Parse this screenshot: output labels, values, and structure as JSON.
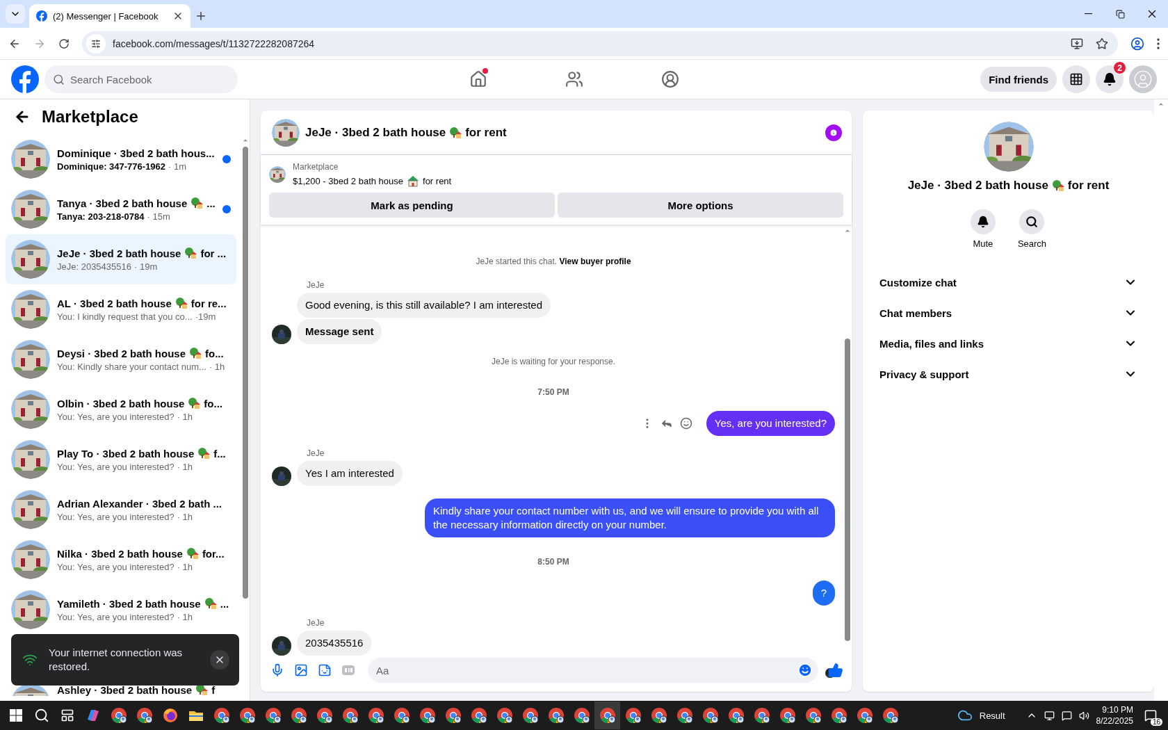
{
  "browser": {
    "tab": {
      "title": "(2) Messenger | Facebook",
      "selected": true
    },
    "url": "facebook.com/messages/t/1132722282087264"
  },
  "header": {
    "search": {
      "placeholder": "Search Facebook"
    },
    "nav": [
      {
        "kind": "home",
        "selected": false,
        "dot": true
      },
      {
        "kind": "friends",
        "selected": false,
        "dot": false
      },
      {
        "kind": "groups",
        "selected": false,
        "dot": false
      }
    ],
    "find_friends": "Find friends",
    "notifications_badge": "2"
  },
  "sidebar": {
    "title": "Marketplace",
    "conversations": [
      {
        "title": {
          "text": "Dominique · 3bed 2 bath hous...",
          "kind": "plain"
        },
        "preview": "Dominique: 347-776-1962",
        "time": "· 1m",
        "unread": true,
        "selected": false
      },
      {
        "title": {
          "text": "Tanya · 3bed 2 bath house",
          "kind": "house_tree",
          "after": "..."
        },
        "preview": "Tanya: 203-218-0784",
        "time": "· 15m",
        "unread": true,
        "selected": false
      },
      {
        "title": {
          "text": "JeJe · 3bed 2 bath house",
          "kind": "house_tree",
          "after": "for ..."
        },
        "preview": "JeJe: 2035435516",
        "time": "· 19m",
        "unread": false,
        "selected": true
      },
      {
        "title": {
          "text": "AL · 3bed 2 bath house",
          "kind": "house_tree",
          "after": "for re..."
        },
        "preview": "You: I kindly request that you co...",
        "time": "·19m",
        "unread": false,
        "selected": false
      },
      {
        "title": {
          "text": "Deysi · 3bed 2 bath house",
          "kind": "house_tree",
          "after": "fo..."
        },
        "preview": "You: Kindly share your contact num...",
        "time": "· 1h",
        "unread": false,
        "selected": false
      },
      {
        "title": {
          "text": "Olbin · 3bed 2 bath house",
          "kind": "house_tree",
          "after": "fo..."
        },
        "preview": "You: Yes, are you interested?",
        "time": "· 1h",
        "unread": false,
        "selected": false
      },
      {
        "title": {
          "text": "Play To · 3bed 2 bath house",
          "kind": "house_tree",
          "after": "f..."
        },
        "preview": "You: Yes, are you interested?",
        "time": "· 1h",
        "unread": false,
        "selected": false
      },
      {
        "title": {
          "text": "Adrian Alexander · 3bed 2 bath ...",
          "kind": "plain"
        },
        "preview": "You: Yes, are you interested?",
        "time": "· 1h",
        "unread": false,
        "selected": false
      },
      {
        "title": {
          "text": "Nilka · 3bed 2 bath house",
          "kind": "house_tree",
          "after": "for..."
        },
        "preview": "You: Yes, are you interested?",
        "time": "· 1h",
        "unread": false,
        "selected": false
      },
      {
        "title": {
          "text": "Yamileth · 3bed 2 bath house",
          "kind": "house_tree",
          "after": "..."
        },
        "preview": "You: Yes, are you interested?",
        "time": "· 1h",
        "unread": false,
        "selected": false
      },
      {
        "title": {
          "text": "Ashley · 3bed 2 bath house",
          "kind": "house_tree",
          "after": "f"
        },
        "selected": false
      }
    ],
    "toast": "Your internet connection was restored."
  },
  "chat": {
    "title": {
      "text": "JeJe · 3bed 2 bath house",
      "kind": "house_tree",
      "after": "for rent"
    },
    "listing": {
      "label": "Marketplace",
      "title": {
        "text": "$1,200 - 3bed 2 bath house",
        "kind": "house",
        "after": "for rent"
      },
      "buttons": [
        "Mark as pending",
        "More options"
      ]
    },
    "messages": [
      {
        "kind": "system",
        "text": "JeJe started this chat.",
        "link": "View buyer profile"
      },
      {
        "kind": "incoming",
        "sender": "JeJe",
        "bubbles": [
          {
            "text": "Good evening, is this still available? I am interested",
            "bold": false
          },
          {
            "text": "Message sent",
            "bold": true
          }
        ]
      },
      {
        "kind": "system",
        "text": "JeJe is waiting for your response."
      },
      {
        "kind": "time",
        "text": "7:50 PM"
      },
      {
        "kind": "outgoing",
        "text": "Yes, are you interested?",
        "color": "#6530f6",
        "actions": true
      },
      {
        "kind": "incoming",
        "sender": "JeJe",
        "bubbles": [
          {
            "text": "Yes I am interested",
            "bold": false
          }
        ]
      },
      {
        "kind": "outgoing",
        "text": "Kindly share your contact number with us, and we will ensure to provide you with all the necessary information directly on your number.",
        "color": "#3a4ff5"
      },
      {
        "kind": "time",
        "text": "8:50 PM"
      },
      {
        "kind": "outgoing",
        "text": "?",
        "color": "#1f6cf5"
      },
      {
        "kind": "incoming",
        "sender": "JeJe",
        "bubbles": [
          {
            "text": "2035435516",
            "bold": false
          }
        ]
      },
      {
        "kind": "receipt"
      }
    ],
    "composer": {
      "placeholder": "Aa"
    }
  },
  "details": {
    "title": {
      "text": "JeJe · 3bed 2 bath house",
      "kind": "house_tree",
      "after": "for rent"
    },
    "actions": [
      {
        "kind": "mute",
        "label": "Mute"
      },
      {
        "kind": "search",
        "label": "Search"
      }
    ],
    "sections": [
      {
        "label": "Customize chat",
        "expanded": false
      },
      {
        "label": "Chat members",
        "expanded": false
      },
      {
        "label": "Media, files and links",
        "expanded": false
      },
      {
        "label": "Privacy & support",
        "expanded": false
      }
    ]
  },
  "taskbar": {
    "apps": [
      {
        "kind": "copilot",
        "selected": false
      },
      {
        "kind": "chrome",
        "selected": false
      },
      {
        "kind": "chrome",
        "selected": false
      },
      {
        "kind": "firefox",
        "selected": false
      },
      {
        "kind": "files",
        "selected": false
      },
      {
        "kind": "chrome",
        "selected": false
      },
      {
        "kind": "chrome",
        "selected": false
      },
      {
        "kind": "chrome",
        "selected": false
      },
      {
        "kind": "chrome",
        "selected": false
      },
      {
        "kind": "chrome",
        "selected": false
      },
      {
        "kind": "chrome",
        "selected": false
      },
      {
        "kind": "chrome",
        "selected": false
      },
      {
        "kind": "chrome",
        "selected": false
      },
      {
        "kind": "chrome",
        "selected": false
      },
      {
        "kind": "chrome",
        "selected": false
      },
      {
        "kind": "chrome",
        "selected": false
      },
      {
        "kind": "chrome",
        "selected": false
      },
      {
        "kind": "chrome",
        "selected": false
      },
      {
        "kind": "chrome",
        "selected": false
      },
      {
        "kind": "chrome",
        "selected": false
      },
      {
        "kind": "chrome",
        "selected": true
      },
      {
        "kind": "chrome",
        "selected": false
      },
      {
        "kind": "chrome",
        "selected": false
      },
      {
        "kind": "chrome",
        "selected": false
      },
      {
        "kind": "chrome",
        "selected": false
      },
      {
        "kind": "chrome",
        "selected": false
      },
      {
        "kind": "chrome",
        "selected": false
      },
      {
        "kind": "chrome",
        "selected": false
      },
      {
        "kind": "chrome",
        "selected": false
      },
      {
        "kind": "chrome",
        "selected": false
      },
      {
        "kind": "chrome",
        "selected": false
      },
      {
        "kind": "chrome",
        "selected": false
      }
    ],
    "weather": "Result",
    "time": "9:10 PM",
    "date": "8/22/2025",
    "notifications": "16"
  }
}
